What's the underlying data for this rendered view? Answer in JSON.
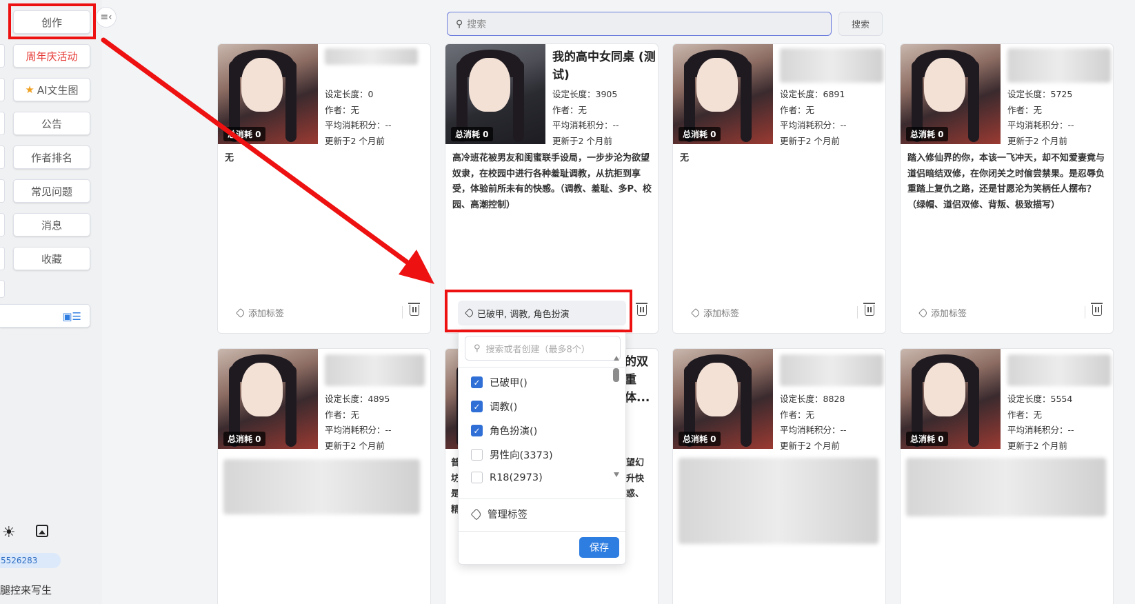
{
  "sidebar": {
    "create": "创作",
    "anniversary": "周年庆活动",
    "ai_image": "AI文生图",
    "notice": "公告",
    "author_rank": "作者排名",
    "faq": "常见问题",
    "messages": "消息",
    "favorites": "收藏",
    "user_id": "5526283",
    "user_name": "腿控来写生"
  },
  "search": {
    "placeholder": "搜索",
    "button": "搜索"
  },
  "labels": {
    "length": "设定长度：",
    "author": "作者：",
    "avg_points": "平均消耗积分：",
    "updated": "更新于2 个月前",
    "total_cost": "总消耗 0",
    "add_tag": "添加标签"
  },
  "cards": [
    {
      "title": "",
      "length": "0",
      "author": "无",
      "avg": "--",
      "desc": "无"
    },
    {
      "title": "我的高中女同桌 (测试)",
      "length": "3905",
      "author": "无",
      "avg": "--",
      "desc": "高冷班花被男友和闺蜜联手设局，一步步沦为欲望奴隶，在校园中进行各种羞耻调教，从抗拒到享受，体验前所未有的快感。（调教、羞耻、多P、校园、高潮控制）",
      "tags": "已破甲, 调教, 角色扮演"
    },
    {
      "title": "",
      "length": "6891",
      "author": "无",
      "avg": "--",
      "desc": "无"
    },
    {
      "title": "",
      "length": "5725",
      "author": "无",
      "avg": "--",
      "desc": "踏入修仙界的你，本该一飞冲天，却不知爱妻竟与道侣暗结双修，在你闭关之时偷尝禁果。是忍辱负重踏上复仇之路，还是甘愿沦为笑柄任人摆布？（绿帽、道侣双修、背叛、极致描写）"
    },
    {
      "title": "",
      "length": "4895",
      "author": "无",
      "avg": "--",
      "desc": ""
    },
    {
      "title": "的双重体...",
      "length": "",
      "author": "",
      "avg": "",
      "desc": ""
    },
    {
      "title": "",
      "length": "8828",
      "author": "无",
      "avg": "--",
      "desc": ""
    },
    {
      "title": "",
      "length": "5554",
      "author": "无",
      "avg": "--",
      "desc": ""
    }
  ],
  "card6_fragments": {
    "line1": "普",
    "line2": "坊",
    "line3": "是",
    "line4": "精",
    "right1": "望幻",
    "right2": "升快",
    "right3": "惑、"
  },
  "dropdown": {
    "placeholder": "搜索或者创建（最多8个）",
    "options": [
      {
        "label": "已破甲()",
        "checked": true
      },
      {
        "label": "调教()",
        "checked": true
      },
      {
        "label": "角色扮演()",
        "checked": true
      },
      {
        "label": "男性向(3373)",
        "checked": false
      },
      {
        "label": "R18(2973)",
        "checked": false
      }
    ],
    "manage": "管理标签",
    "save": "保存"
  },
  "icons": {
    "collapse": "collapse-sidebar-icon",
    "star": "star-icon",
    "search": "search-icon",
    "tag": "tag-icon",
    "trash": "trash-icon",
    "sun": "sun-icon",
    "image": "image-icon",
    "layout": "layout-icon"
  },
  "colors": {
    "accent": "#2e7de1",
    "annotation": "#ee1111",
    "anniversary": "#e53935"
  }
}
